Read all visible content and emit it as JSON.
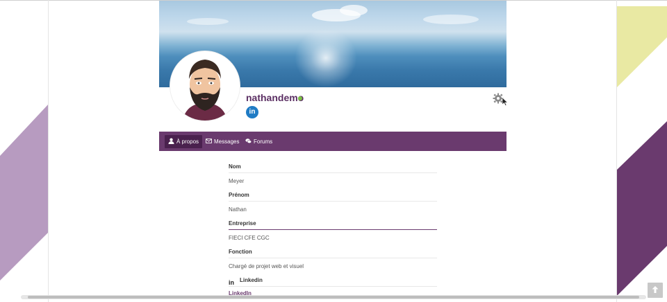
{
  "profile": {
    "username": "nathandemo",
    "linkedin_badge_text": "in"
  },
  "nav": {
    "tabs": [
      {
        "label": "À propos",
        "icon": "user-icon",
        "active": true
      },
      {
        "label": "Messages",
        "icon": "envelope-icon",
        "active": false
      },
      {
        "label": "Forums",
        "icon": "comments-icon",
        "active": false
      }
    ]
  },
  "fields": {
    "nom_label": "Nom",
    "nom_value": "Meyer",
    "prenom_label": "Prénom",
    "prenom_value": "Nathan",
    "entreprise_label": "Entreprise",
    "entreprise_value": "FIECI CFE CGC",
    "fonction_label": "Fonction",
    "fonction_value": "Chargé de projet web et visuel",
    "linkedin_label": "Linkedin",
    "linkedin_icon_text": "in",
    "linkedin_link": "LinkedIn"
  },
  "colors": {
    "brand_purple": "#6a3a6e",
    "username_purple": "#5b2f63",
    "online_green": "#7bc142",
    "linkedin_blue": "#1f7bc4"
  },
  "scroll_top_icon": "arrow-up-icon"
}
